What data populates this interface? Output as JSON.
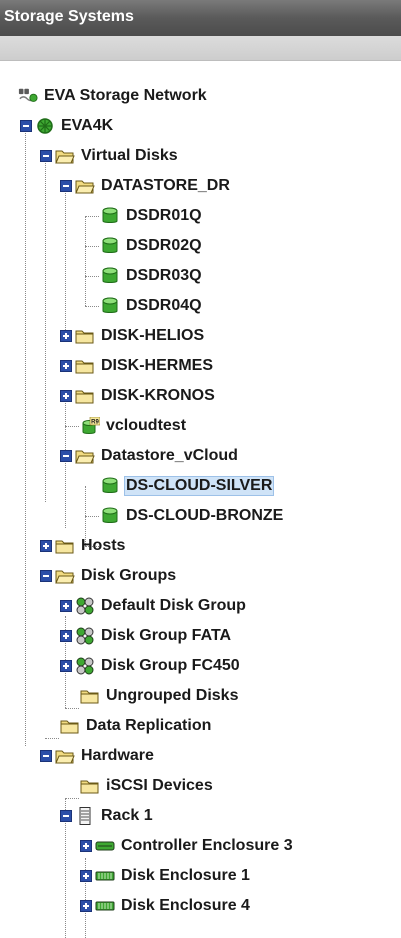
{
  "panel": {
    "title": "Storage Systems"
  },
  "tree": {
    "network": "EVA Storage Network",
    "system": "EVA4K",
    "virtual_disks": {
      "label": "Virtual Disks",
      "datastore_dr": {
        "label": "DATASTORE_DR",
        "children": [
          "DSDR01Q",
          "DSDR02Q",
          "DSDR03Q",
          "DSDR04Q"
        ]
      },
      "disk_helios": "DISK-HELIOS",
      "disk_hermes": "DISK-HERMES",
      "disk_kronos": "DISK-KRONOS",
      "vcloudtest": "vcloudtest",
      "datastore_vcloud": {
        "label": "Datastore_vCloud",
        "children": [
          "DS-CLOUD-SILVER",
          "DS-CLOUD-BRONZE"
        ]
      },
      "selected": "DS-CLOUD-SILVER"
    },
    "hosts": "Hosts",
    "disk_groups": {
      "label": "Disk Groups",
      "children": [
        "Default Disk Group",
        "Disk Group FATA",
        "Disk Group FC450",
        "Ungrouped Disks"
      ]
    },
    "data_replication": "Data Replication",
    "hardware": {
      "label": "Hardware",
      "iscsi": "iSCSI Devices",
      "rack": {
        "label": "Rack 1",
        "children": [
          "Controller Enclosure 3",
          "Disk Enclosure 1",
          "Disk Enclosure 4"
        ]
      }
    }
  },
  "badges": {
    "replication": "R9"
  },
  "colors": {
    "titlebar": "#5a5a5a",
    "expander": "#2c4fa8",
    "folder": "#f2dc82",
    "vdisk": "#3ea832",
    "selection": "#cfe3f7"
  }
}
